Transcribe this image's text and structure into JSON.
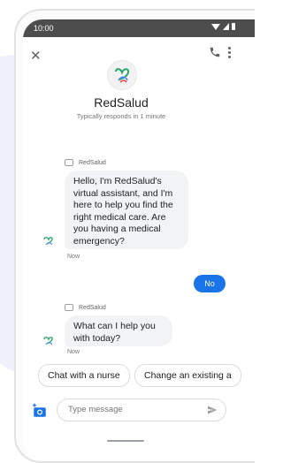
{
  "status_bar": {
    "time": "10:00"
  },
  "header": {
    "business_name": "RedSalud",
    "response_time": "Typically responds in 1 minute"
  },
  "messages": [
    {
      "sender": "RedSalud",
      "text": "Hello, I'm RedSalud's virtual assistant, and I'm here to help you find the right medical care. Are you having a medical emergency?",
      "time": "Now"
    },
    {
      "sender": "user",
      "text": "No"
    },
    {
      "sender": "RedSalud",
      "text": "What can I help you with today?",
      "time": "Now"
    }
  ],
  "suggestions": [
    "Chat with a nurse",
    "Change an existing a"
  ],
  "composer": {
    "placeholder": "Type message"
  },
  "colors": {
    "accent": "#1a73e8",
    "status_bar": "#4d4d4d",
    "received_bubble": "#f1f3f4"
  },
  "icons": [
    "close-icon",
    "phone-icon",
    "more-vert-icon",
    "add-photo-icon",
    "send-icon"
  ]
}
